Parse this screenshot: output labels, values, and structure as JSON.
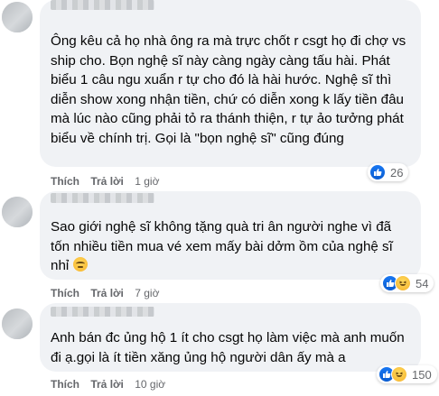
{
  "comments": [
    {
      "text": "Ông kêu cả họ nhà ông ra mà trực chốt r csgt họ đi chợ vs ship cho. Bọn nghệ sĩ này càng ngày càng tấu hài. Phát biểu 1 câu ngu xuẩn r tự cho đó là hài hước. Nghệ sĩ thì diễn show xong nhận tiền, chứ có diễn xong k lấy tiền đâu mà lúc nào cũng phải tỏ ra thánh thiện, r tự ảo tưởng phát biểu về chính trị. Gọi là \"bọn nghệ sĩ\" cũng đúng",
      "like_label": "Thích",
      "reply_label": "Trả lời",
      "time": "1 giờ",
      "reactions": [
        "like-icon"
      ],
      "reaction_count": "26"
    },
    {
      "text": "Sao giới nghệ sĩ không tặng quà tri ân người nghe vì đã tốn nhiều tiền mua vé xem mấy bài dởm ồm của nghệ sĩ nhỉ",
      "like_label": "Thích",
      "reply_label": "Trả lời",
      "time": "7 giờ",
      "reactions": [
        "like-icon",
        "haha-icon"
      ],
      "reaction_count": "54"
    },
    {
      "text": "Anh bán đc ủng hộ 1 ít cho csgt họ làm việc mà anh muốn đi ạ.gọi là ít tiền xăng ủng hộ người dân ấy mà a",
      "like_label": "Thích",
      "reply_label": "Trả lời",
      "time": "10 giờ",
      "reactions": [
        "like-icon",
        "haha-icon"
      ],
      "reaction_count": "150"
    }
  ]
}
